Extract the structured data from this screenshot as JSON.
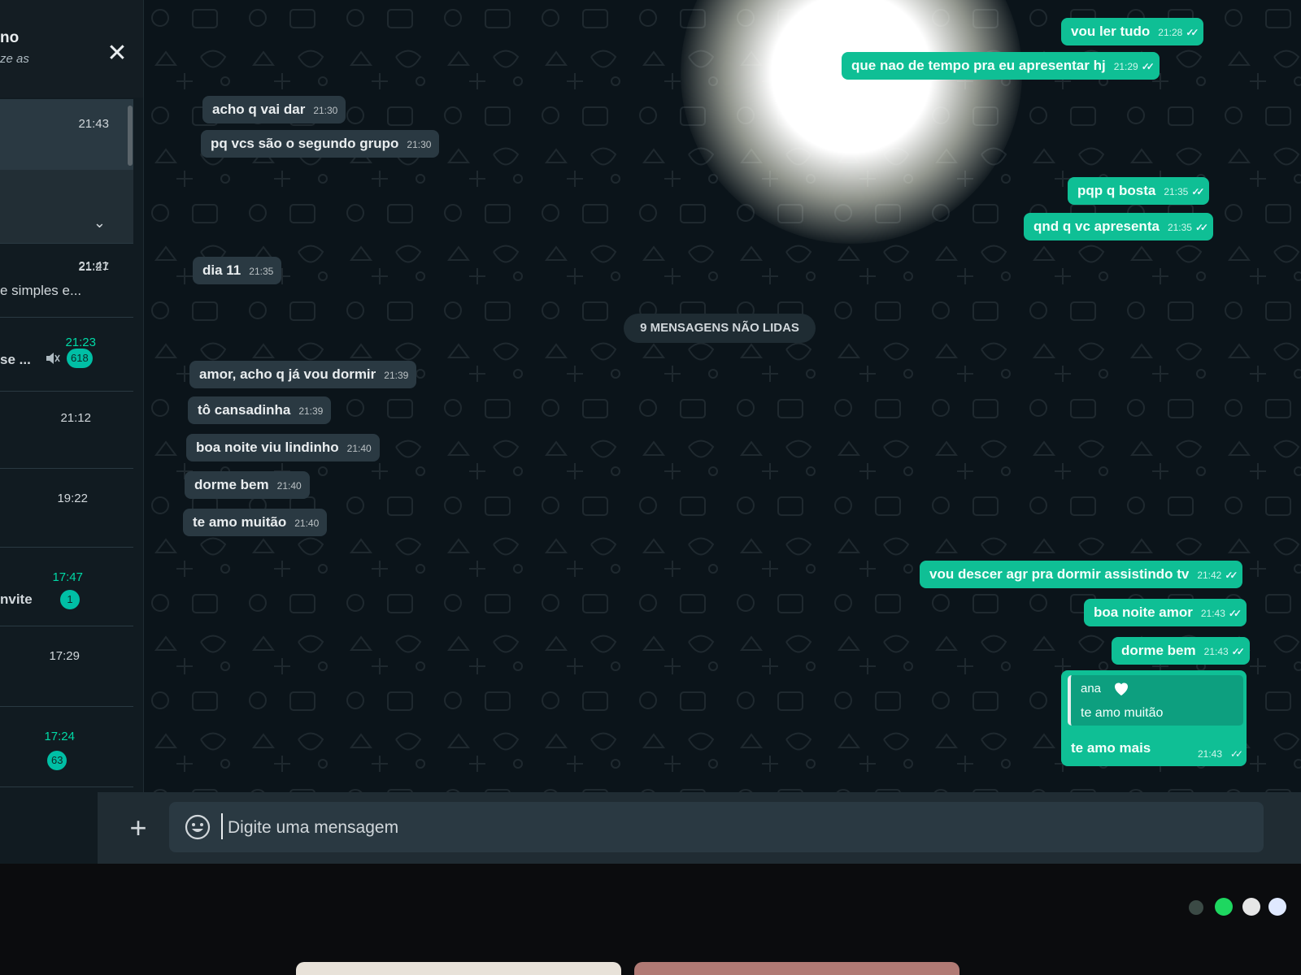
{
  "sidebar": {
    "title": "no",
    "subtitle": "ze as",
    "chats": [
      {
        "time": "21:43",
        "snippet": ""
      },
      {
        "time": "21:41",
        "snippet": ""
      },
      {
        "time": "21:27",
        "snippet": "e simples e..."
      },
      {
        "time": "21:23",
        "snippet": "se ...",
        "badge": "618"
      },
      {
        "time": "21:12",
        "snippet": ""
      },
      {
        "time": "19:22",
        "snippet": ""
      },
      {
        "time": "17:47",
        "snippet": "nvite",
        "badge": "1"
      },
      {
        "time": "17:29",
        "snippet": ""
      },
      {
        "time": "17:24",
        "snippet": "",
        "badge": "63"
      }
    ]
  },
  "chat": {
    "unread_banner": "9 MENSAGENS NÃO LIDAS",
    "messages": [
      {
        "dir": "out",
        "text": "vou ler tudo",
        "time": "21:28"
      },
      {
        "dir": "out",
        "text": "que nao de tempo pra eu apresentar hj",
        "time": "21:29"
      },
      {
        "dir": "in",
        "text": "acho q vai dar",
        "time": "21:30"
      },
      {
        "dir": "in",
        "text": "pq vcs são o segundo grupo",
        "time": "21:30"
      },
      {
        "dir": "out",
        "text": "pqp q bosta",
        "time": "21:35"
      },
      {
        "dir": "out",
        "text": "qnd q vc apresenta",
        "time": "21:35"
      },
      {
        "dir": "in",
        "text": "dia 11",
        "time": "21:35"
      },
      {
        "dir": "in",
        "text": "amor, acho q já vou dormir",
        "time": "21:39"
      },
      {
        "dir": "in",
        "text": "tô cansadinha",
        "time": "21:39"
      },
      {
        "dir": "in",
        "text": "boa noite viu lindinho",
        "time": "21:40"
      },
      {
        "dir": "in",
        "text": "dorme bem",
        "time": "21:40"
      },
      {
        "dir": "in",
        "text": "te amo muitão",
        "time": "21:40"
      },
      {
        "dir": "out",
        "text": "vou descer agr pra dormir assistindo tv",
        "time": "21:42"
      },
      {
        "dir": "out",
        "text": "boa noite amor",
        "time": "21:43"
      },
      {
        "dir": "out",
        "text": "dorme bem",
        "time": "21:43"
      }
    ],
    "reply": {
      "quote_author": "ana",
      "quote_text": "te amo muitão",
      "text": "te amo mais",
      "time": "21:43"
    }
  },
  "composer": {
    "placeholder": "Digite uma mensagem"
  },
  "colors": {
    "outgoing": "#0fbf95",
    "incoming": "#2a3942",
    "background": "#0b141a",
    "badge": "#00bfa5"
  }
}
